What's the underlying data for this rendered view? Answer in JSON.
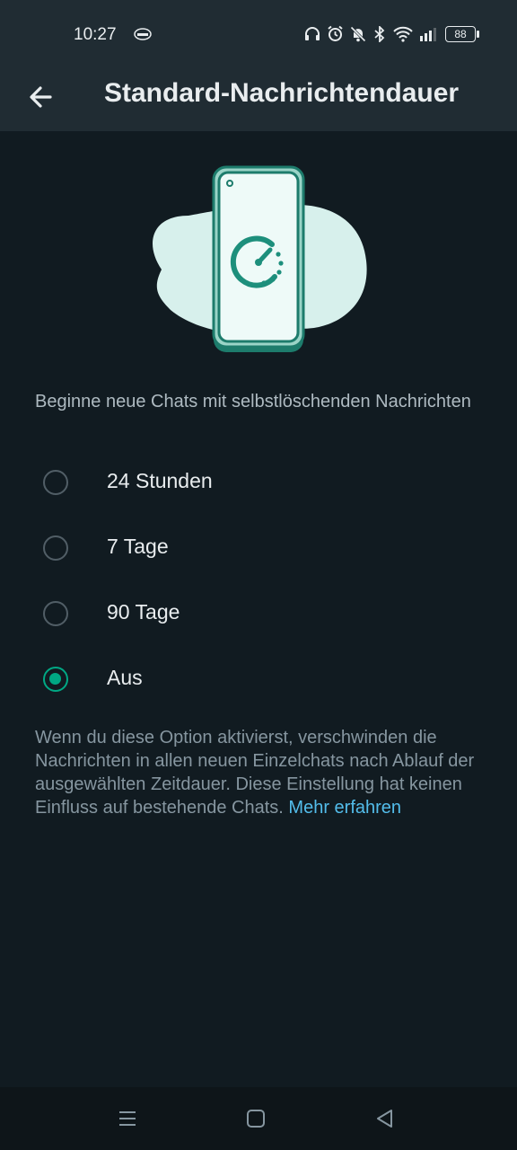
{
  "status_bar": {
    "time": "10:27",
    "battery": "88",
    "icons": [
      "headphones-icon",
      "alarm-icon",
      "bell-off-icon",
      "bluetooth-icon",
      "wifi-icon",
      "signal-icon",
      "battery-icon"
    ]
  },
  "app_bar": {
    "title": "Standard-Nachrichtendauer",
    "back_icon": "arrow-left-icon"
  },
  "illustration": "phone-timer-icon",
  "section_label": "Beginne neue Chats mit selbstlöschenden Nachrichten",
  "options": [
    {
      "label": "24 Stunden",
      "selected": false
    },
    {
      "label": "7 Tage",
      "selected": false
    },
    {
      "label": "90 Tage",
      "selected": false
    },
    {
      "label": "Aus",
      "selected": true
    }
  ],
  "description": {
    "text": "Wenn du diese Option aktivierst, verschwinden die Nachrichten in allen neuen Einzelchats nach Ablauf der ausgewählten Zeitdauer. Diese Einstellung hat keinen Einfluss auf bestehende Chats.",
    "link": "Mehr erfahren"
  },
  "nav_bar": {
    "icons": [
      "menu-icon",
      "home-icon",
      "back-triangle-icon"
    ]
  },
  "colors": {
    "background": "#111b21",
    "app_bar": "#202c33",
    "accent": "#00a884",
    "link": "#53bdeb"
  }
}
